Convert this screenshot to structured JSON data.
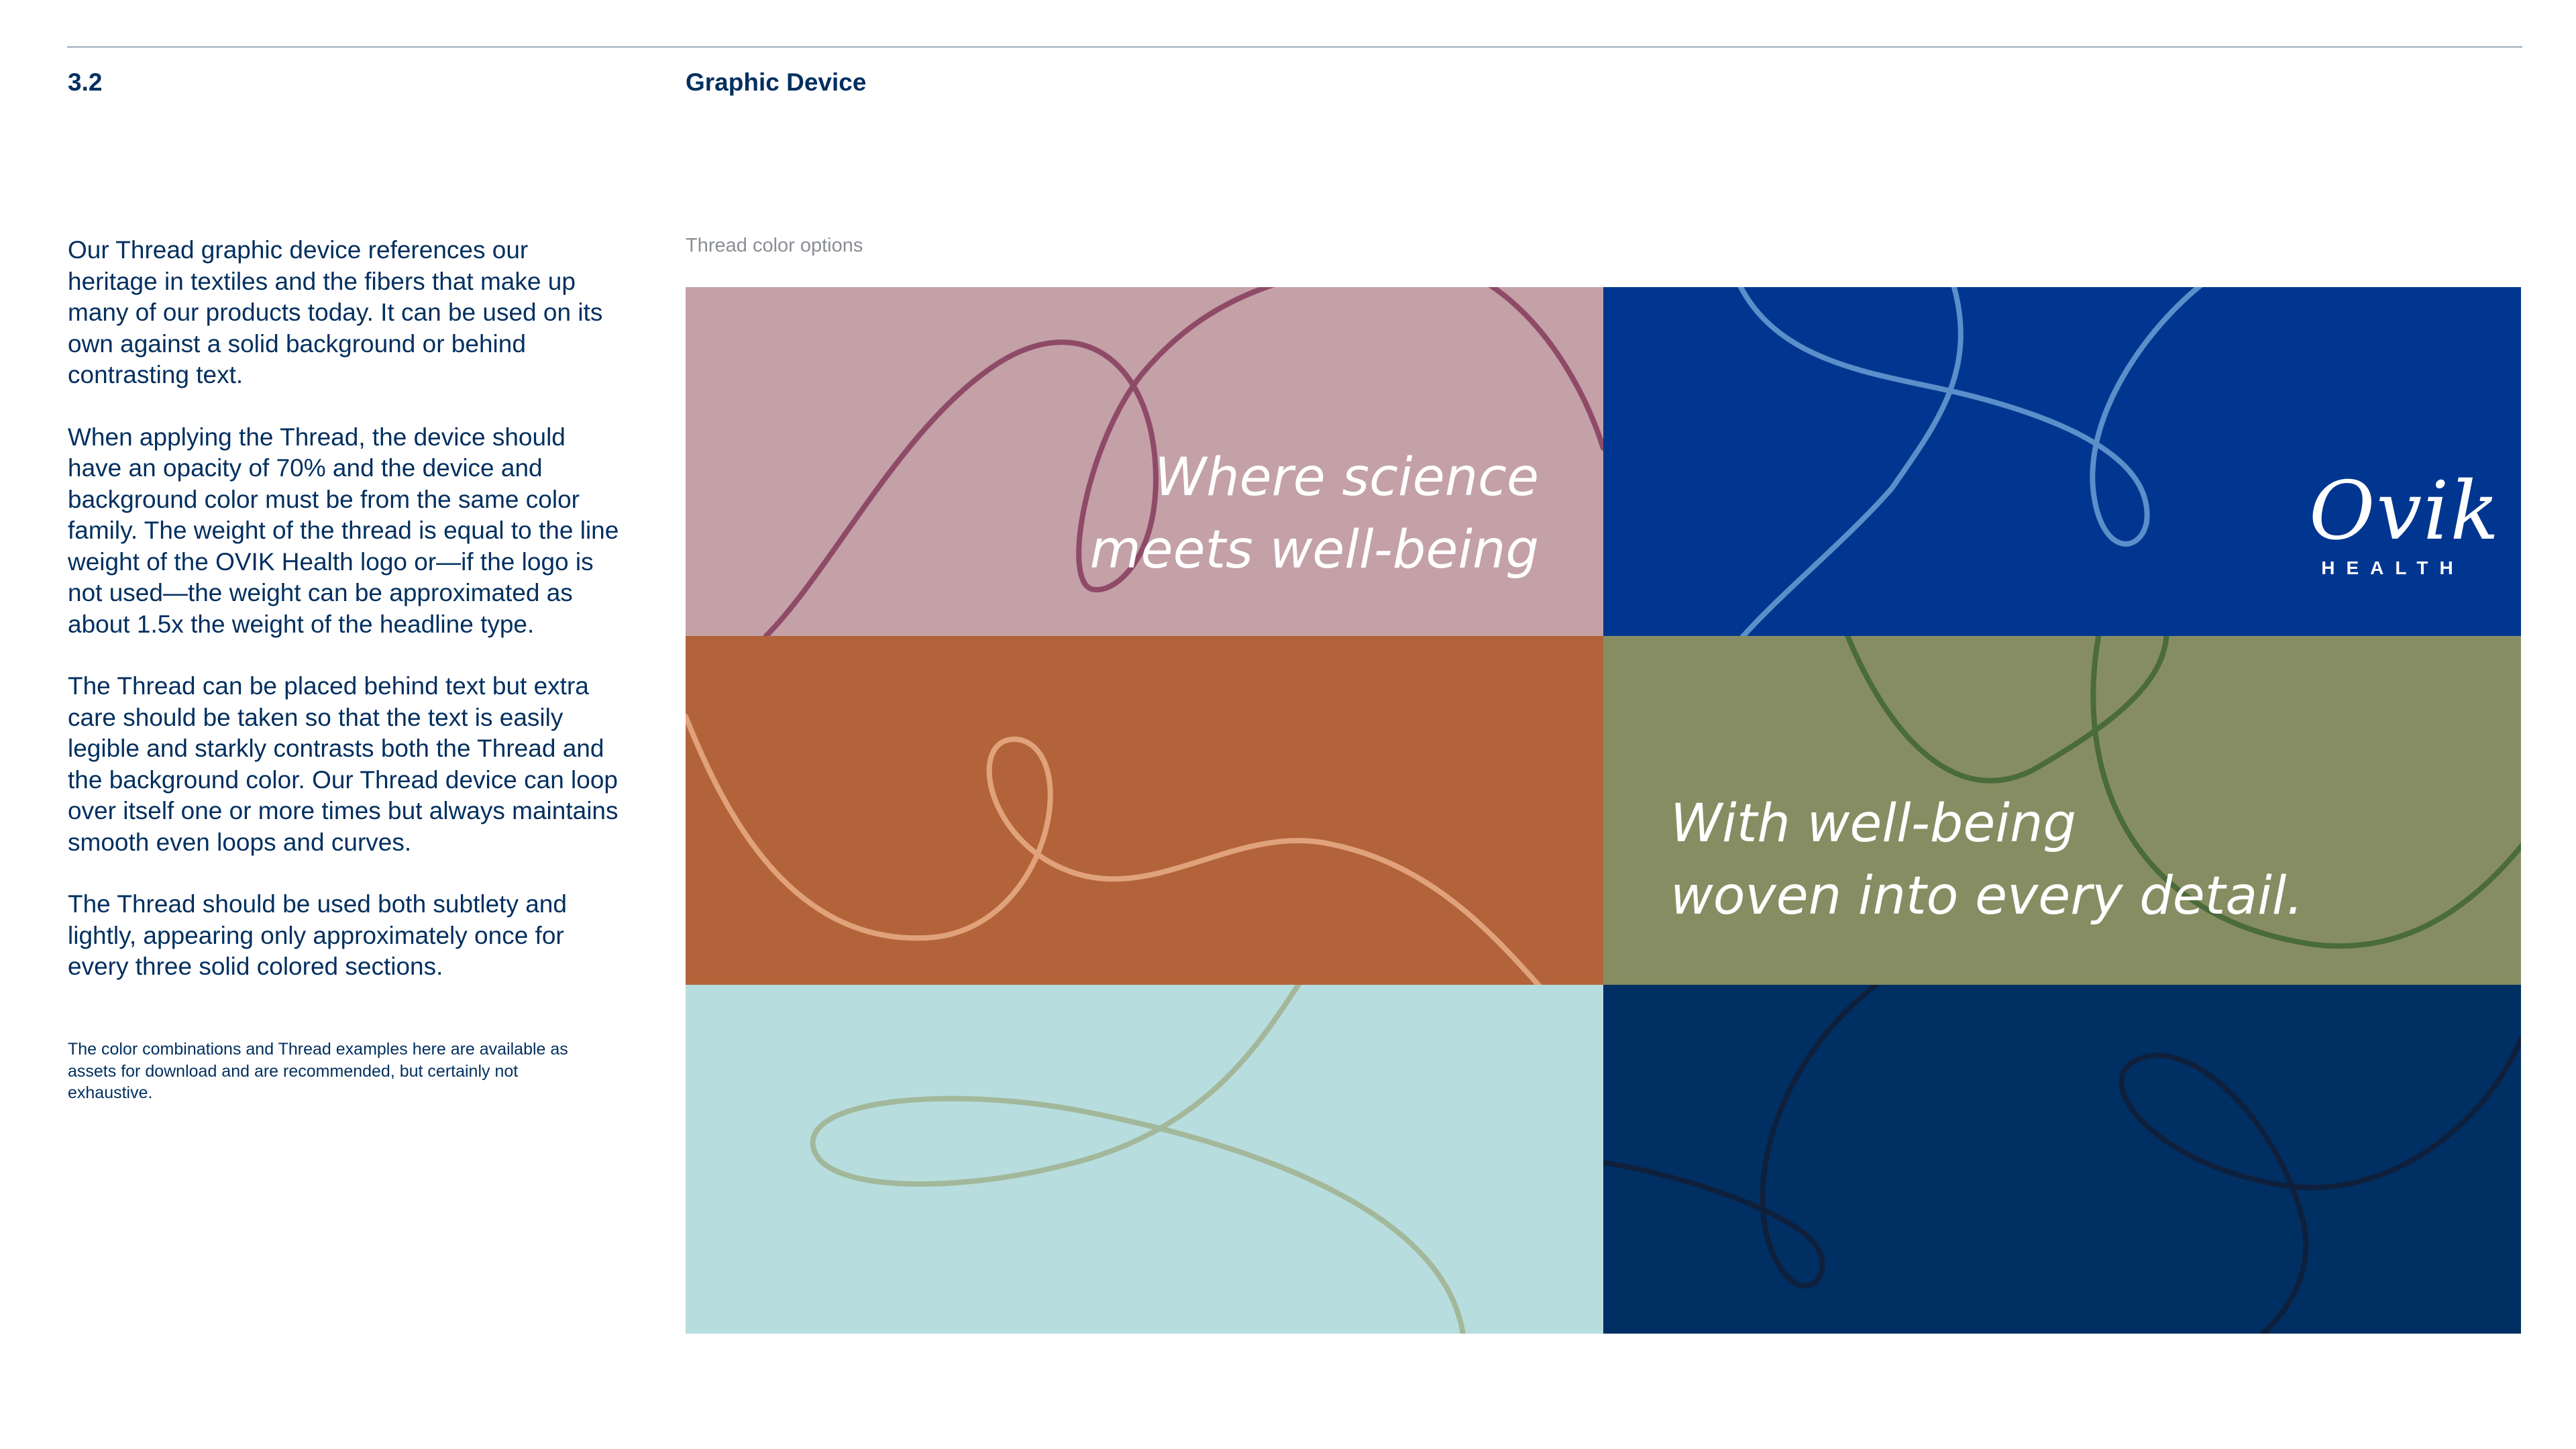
{
  "header": {
    "section_number": "3.2",
    "section_title": "Graphic Device"
  },
  "body": {
    "paragraphs": [
      "Our Thread graphic device references our heritage in textiles and the fibers that make up many of our products today. It can be used on its own against a solid background or behind contrasting text.",
      "When applying the Thread, the device should have an opacity of 70% and the device and background color must be from the same color family. The weight of the thread is equal to the line weight of the OVIK Health logo or—if the logo is not used—the weight can be approximated as about 1.5x the weight of the headline type.",
      "The Thread can be placed behind text but extra care should be taken so that the text is easily legible and starkly contrasts both the Thread and the background color. Our Thread device can loop over itself one or more times but always maintains smooth even loops and curves.",
      "The Thread should be used both subtlety and lightly, appearing only approximately once for every three solid colored sections."
    ],
    "fine_print": "The color combinations and Thread examples here are available as assets for download and are recommended, but certainly not exhaustive."
  },
  "thread_grid": {
    "caption": "Thread color options",
    "panels": [
      {
        "name": "mauve",
        "background": "#c3a1a7",
        "thread": "#8f4a68"
      },
      {
        "name": "blue",
        "background": "#003690",
        "thread": "#5b8fc9"
      },
      {
        "name": "rust",
        "background": "#b3633a",
        "thread": "#e0a27a"
      },
      {
        "name": "olive",
        "background": "#878d62",
        "thread": "#4a6b3a"
      },
      {
        "name": "aqua",
        "background": "#b8dddf",
        "thread": "#a3b89a"
      },
      {
        "name": "navy",
        "background": "#002f63",
        "thread": "#0f203d"
      }
    ],
    "tagline_1": {
      "line1": "Where science",
      "line2": "meets well-being"
    },
    "tagline_2": {
      "line1": "With well-being",
      "line2": "woven into every detail."
    },
    "logo": {
      "wordmark": "Ovik",
      "sub": "HEALTH"
    }
  }
}
